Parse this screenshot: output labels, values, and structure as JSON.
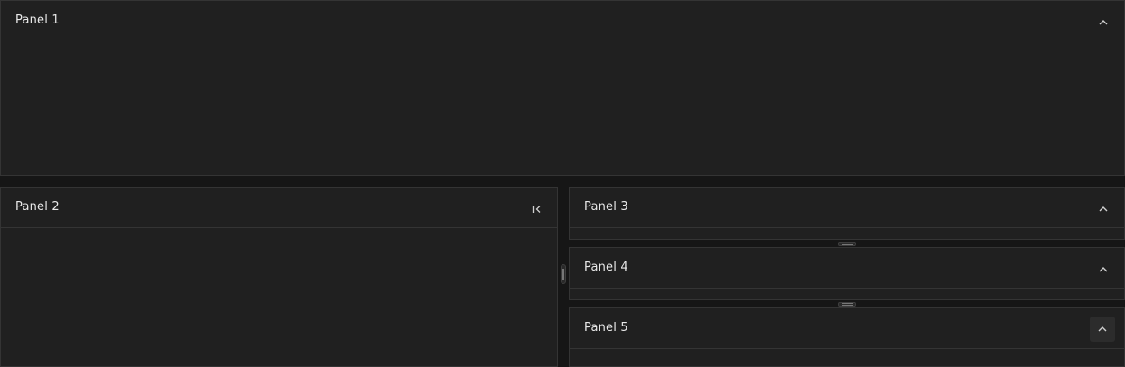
{
  "panels": {
    "panel1": {
      "title": "Panel 1",
      "action_icon": "chevron-up-icon"
    },
    "panel2": {
      "title": "Panel 2",
      "action_icon": "collapse-left-icon"
    },
    "panel3": {
      "title": "Panel 3",
      "action_icon": "chevron-up-icon"
    },
    "panel4": {
      "title": "Panel 4",
      "action_icon": "chevron-up-icon"
    },
    "panel5": {
      "title": "Panel 5",
      "action_icon": "chevron-up-icon"
    }
  },
  "colors": {
    "background": "#161616",
    "panel": "#202020",
    "border": "#343434",
    "text": "#e8e8e8"
  }
}
